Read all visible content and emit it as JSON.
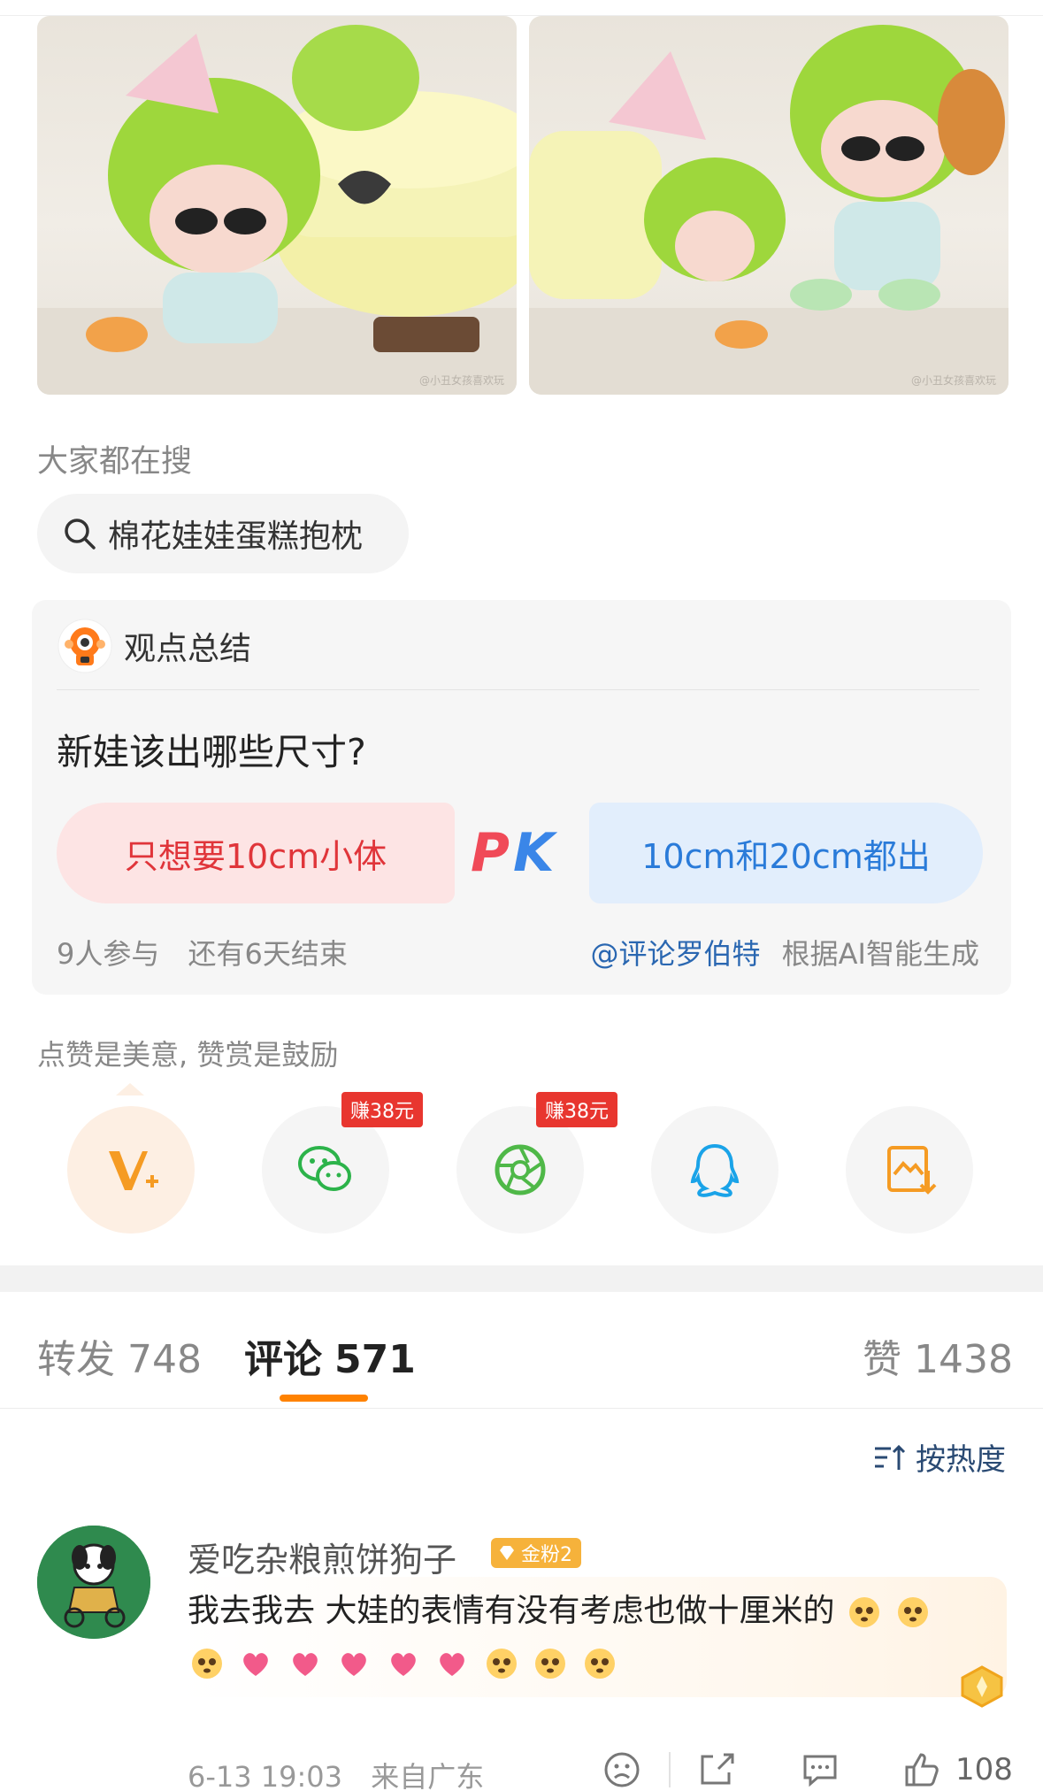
{
  "photos": {
    "left_watermark": "@小丑女孩喜欢玩",
    "right_watermark": "@小丑女孩喜欢玩"
  },
  "trending": {
    "title": "大家都在搜",
    "query": "棉花娃娃蛋糕抱枕"
  },
  "opinion_card": {
    "header": "观点总结",
    "question": "新娃该出哪些尺寸?",
    "option_left": "只想要10cm小体",
    "pk_label": "PK",
    "option_right": "10cm和20cm都出",
    "participants": "9人参与",
    "time_left": "还有6天结束",
    "author": "@评论罗伯特",
    "generated_note": "根据AI智能生成"
  },
  "reward": {
    "text": "点赞是美意, 赞赏是鼓励"
  },
  "share": {
    "items": [
      {
        "icon": "vip-v-plus-icon"
      },
      {
        "icon": "wechat-icon",
        "badge": "赚38元"
      },
      {
        "icon": "moments-icon",
        "badge": "赚38元"
      },
      {
        "icon": "qq-icon"
      },
      {
        "icon": "save-image-icon"
      }
    ]
  },
  "tabs": {
    "repost_label": "转发",
    "repost_count": "748",
    "comment_label": "评论",
    "comment_count": "571",
    "like_label": "赞",
    "like_count": "1438"
  },
  "sort": {
    "label": "按热度"
  },
  "comment": {
    "username": "爱吃杂粮煎饼狗子",
    "fan_badge": "金粉2",
    "text": "我去我去 大娃的表情有没有考虑也做十厘米的",
    "date": "6-13 19:03",
    "location": "来自广东",
    "likes": "108"
  },
  "colors": {
    "accent_orange": "#ff8200",
    "pk_red": "#e0353a",
    "pk_blue": "#2a7bd9",
    "link_blue": "#2a67b1",
    "earn_red": "#e8362f"
  }
}
